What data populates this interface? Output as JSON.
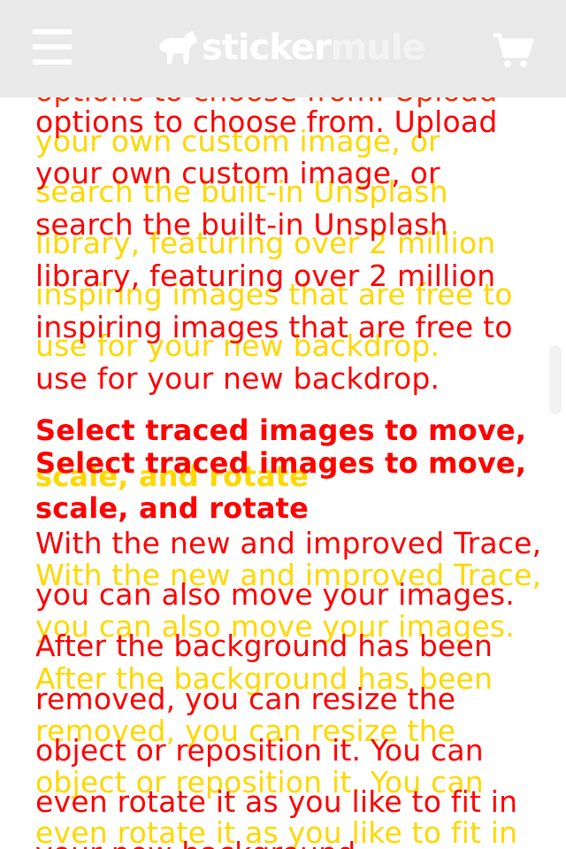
{
  "header": {
    "menu_icon": "hamburger-menu-icon",
    "logo_primary": "sticker",
    "logo_secondary": "mule",
    "logo_mark_icon": "mule-logo-icon",
    "cart_icon": "shopping-cart-icon",
    "background": "#e9e9e9"
  },
  "article": {
    "text_color": "#ff0000",
    "ghost_color": "#ffd800",
    "paragraph1": [
      "options to choose from. Upload",
      "your own custom image, or",
      "search the built-in Unsplash",
      "library, featuring over 2 million",
      "inspiring images that are free to",
      "use for your new backdrop."
    ],
    "heading": [
      "Select traced images to move,",
      "scale, and rotate"
    ],
    "paragraph2": [
      "With the new and improved Trace,",
      "you can also move your images.",
      "After the background has been",
      "removed, you can resize the",
      "object or reposition it. You can",
      "even rotate it as you like to fit in",
      "your new background."
    ]
  }
}
